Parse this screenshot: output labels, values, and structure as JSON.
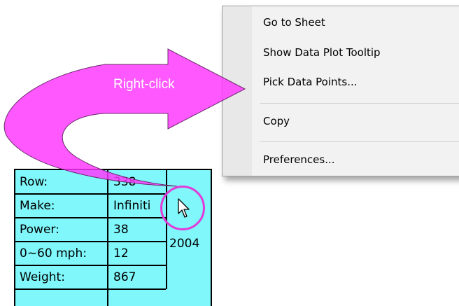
{
  "context_menu": {
    "items": [
      {
        "label": "Go to Sheet"
      },
      {
        "label": "Show Data Plot Tooltip"
      },
      {
        "label": "Pick Data Points..."
      },
      {
        "label": "Copy"
      },
      {
        "label": "Preferences..."
      }
    ]
  },
  "annotation": {
    "label": "Right-click",
    "arrow_color": "#ff33ff"
  },
  "tooltip": {
    "background": "#7ff7fb",
    "rows": [
      {
        "label": "Row:",
        "value": "338"
      },
      {
        "label": "Make:",
        "value": "Infiniti"
      },
      {
        "label": "Power:",
        "value": "38"
      },
      {
        "label": "0~60 mph:",
        "value": "12"
      },
      {
        "label": "Weight:",
        "value": "867"
      }
    ],
    "year": "2004"
  },
  "icons": {
    "cursor": "mouse-pointer-icon",
    "ring": "click-highlight-circle"
  }
}
